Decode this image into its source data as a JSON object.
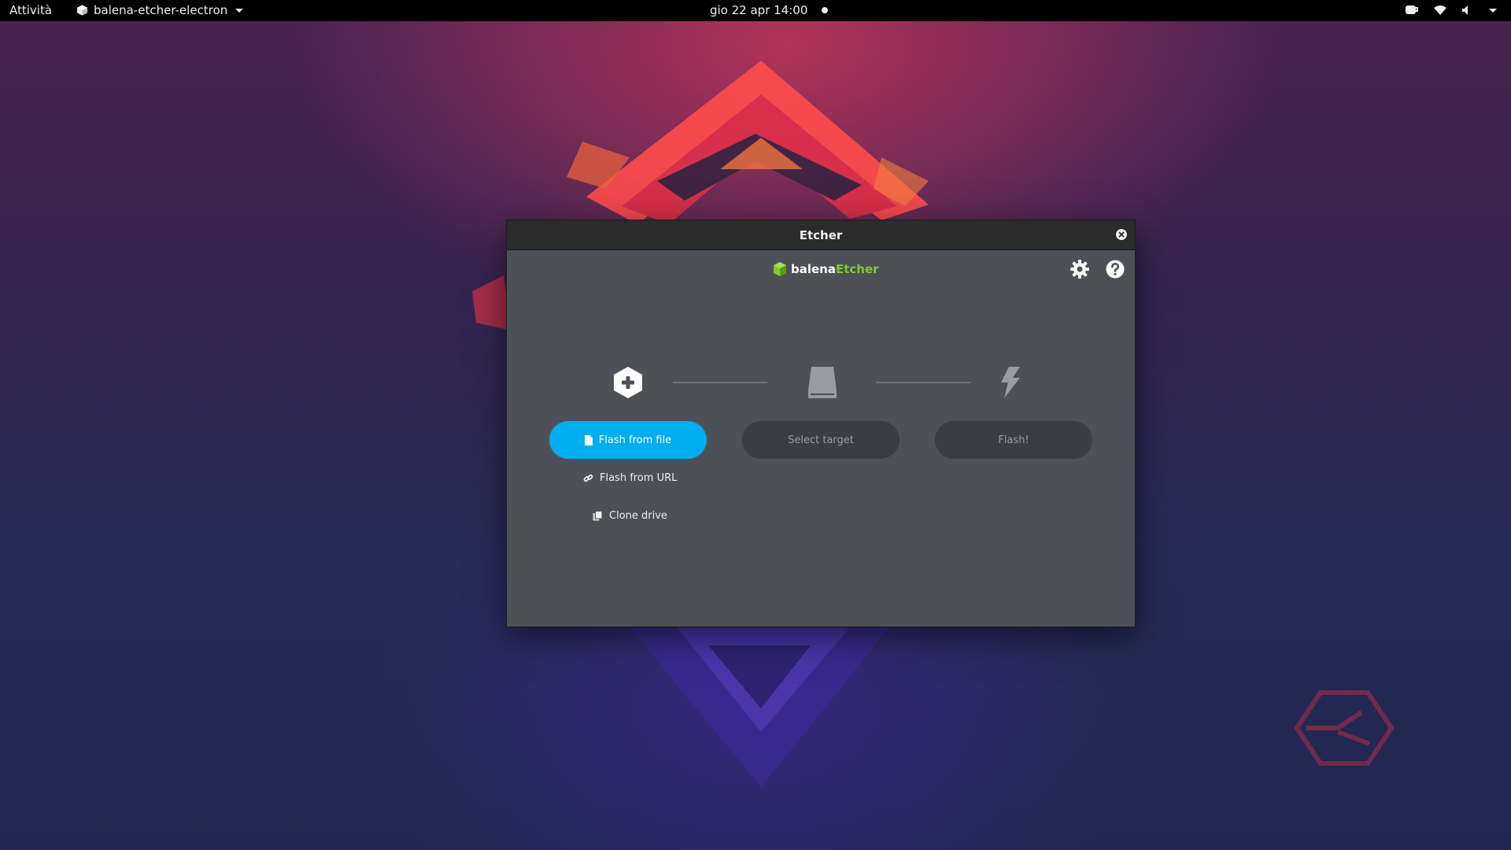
{
  "topbar": {
    "activities": "Attività",
    "app_name": "balena-etcher-electron",
    "clock": "gio 22 apr  14:00"
  },
  "window": {
    "title": "Etcher",
    "brand_part1": "balena",
    "brand_part2": "Etcher",
    "steps": {
      "flash_from_file": "Flash from file",
      "select_target": "Select target",
      "flash": "Flash!",
      "flash_from_url": "Flash from URL",
      "clone_drive": "Clone drive"
    }
  },
  "colors": {
    "accent": "#00aeef",
    "brand_green": "#85c634",
    "window_bg": "#4d5057",
    "disabled_button": "#3b3d42"
  },
  "icons": {
    "topbar": [
      "app-cube-icon",
      "caret-down-icon",
      "notification-dot-icon",
      "coffee-icon",
      "wifi-icon",
      "volume-icon",
      "system-menu-caret-icon"
    ],
    "window": [
      "close-icon",
      "balena-cube-icon",
      "settings-gear-icon",
      "help-icon",
      "hexagon-plus-icon",
      "drive-icon",
      "lightning-icon",
      "file-icon",
      "link-icon",
      "clone-icon"
    ]
  }
}
